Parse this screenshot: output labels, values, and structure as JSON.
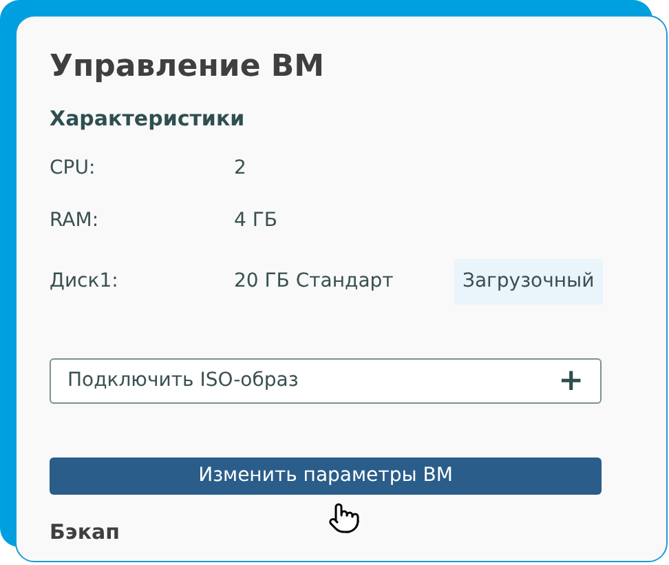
{
  "title": "Управление ВМ",
  "specs_section": {
    "title": "Характеристики",
    "rows": [
      {
        "label": "CPU:",
        "value": "2"
      },
      {
        "label": "RAM:",
        "value": "4 ГБ"
      },
      {
        "label": "Диск1:",
        "value": "20 ГБ Стандарт",
        "badge": "Загрузочный"
      }
    ]
  },
  "iso_button": {
    "label": "Подключить ISO-образ",
    "icon": "+"
  },
  "edit_button": {
    "label": "Изменить параметры ВМ"
  },
  "next_section": {
    "title": "Бэкап"
  }
}
